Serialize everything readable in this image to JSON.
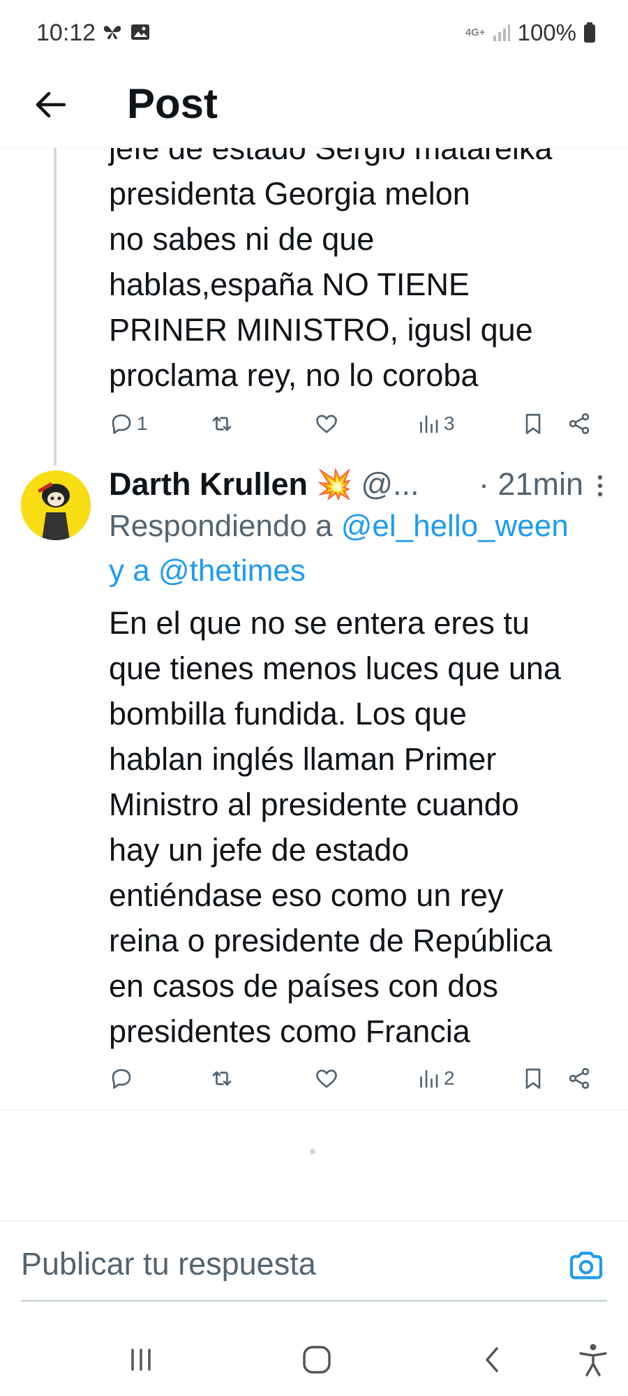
{
  "status_bar": {
    "time": "10:12",
    "network": "4G+",
    "battery": "100%"
  },
  "header": {
    "title": "Post"
  },
  "tweet1": {
    "text": "jefe de estado Sergio matarelka\npresidenta Georgia melon\nno sabes ni de que\nhablas,españa NO TIENE\nPRINER MINISTRO, igusl que\nproclama rey, no lo coroba",
    "replies": "1",
    "views": "3"
  },
  "tweet2": {
    "author_name": "Darth Krullen",
    "author_emoji": "💥",
    "handle": "@...",
    "time": "· 21min",
    "reply_prefix": "Respondiendo a ",
    "mention1": "@el_hello_ween",
    "reply_joiner": "y a ",
    "mention2": "@thetimes",
    "text": "En el que no se entera eres tu\nque tienes menos luces que una\nbombilla fundida. Los que\nhablan inglés llaman Primer\nMinistro al presidente cuando\nhay un jefe de estado\nentiéndase eso como un rey\nreina o presidente de República\nen casos de países con dos\npresidentes como Francia",
    "views": "2"
  },
  "composer": {
    "placeholder": "Publicar tu respuesta"
  },
  "colors": {
    "accent": "#1d9bf0",
    "text": "#0f1419",
    "secondary": "#536471",
    "avatar_bg": "#f8dc14"
  }
}
